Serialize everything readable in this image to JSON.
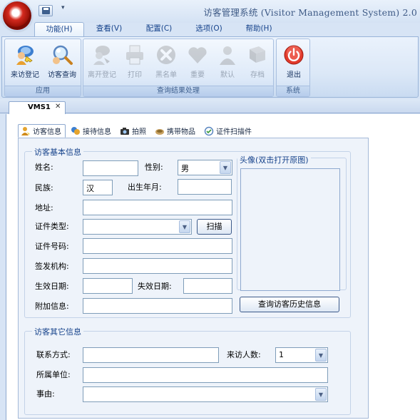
{
  "window": {
    "title": "访客管理系统 (Visitor Management System) 2.0",
    "qat_dropdown": "▾"
  },
  "ribbon_tabs": [
    {
      "label": "功能(H)",
      "active": true
    },
    {
      "label": "查看(V)",
      "active": false
    },
    {
      "label": "配置(C)",
      "active": false
    },
    {
      "label": "选项(O)",
      "active": false
    },
    {
      "label": "帮助(H)",
      "active": false
    }
  ],
  "ribbon_groups": {
    "app": {
      "label": "应用",
      "buttons": [
        {
          "label": "来访登记",
          "icon": "user-key-icon"
        },
        {
          "label": "访客查询",
          "icon": "magnifier-icon"
        }
      ]
    },
    "results": {
      "label": "查询结果处理",
      "buttons": [
        {
          "label": "离开登记",
          "icon": "leave-icon"
        },
        {
          "label": "打印",
          "icon": "printer-icon"
        },
        {
          "label": "黑名单",
          "icon": "blacklist-icon"
        },
        {
          "label": "重要",
          "icon": "heart-icon"
        },
        {
          "label": "默认",
          "icon": "person-icon"
        },
        {
          "label": "存档",
          "icon": "archive-icon"
        }
      ]
    },
    "system": {
      "label": "系统",
      "buttons": [
        {
          "label": "退出",
          "icon": "power-icon"
        }
      ]
    }
  },
  "doc_tab": {
    "label": "VMS1",
    "close": "✕"
  },
  "sub_tabs": [
    {
      "label": "访客信息",
      "icon": "visitor-icon",
      "active": true
    },
    {
      "label": "接待信息",
      "icon": "reception-icon",
      "active": false
    },
    {
      "label": "拍照",
      "icon": "camera-icon",
      "active": false
    },
    {
      "label": "携带物品",
      "icon": "items-icon",
      "active": false
    },
    {
      "label": "证件扫描件",
      "icon": "scan-icon",
      "active": false
    }
  ],
  "basic_info": {
    "title": "访客基本信息",
    "name_label": "姓名:",
    "name_value": "",
    "gender_label": "性别:",
    "gender_value": "男",
    "ethnicity_label": "民族:",
    "ethnicity_value": "汉",
    "birth_label": "出生年月:",
    "birth_value": "",
    "address_label": "地址:",
    "address_value": "",
    "id_type_label": "证件类型:",
    "id_type_value": "",
    "scan_button": "扫描",
    "id_number_label": "证件号码:",
    "id_number_value": "",
    "issuer_label": "签发机构:",
    "issuer_value": "",
    "valid_from_label": "生效日期:",
    "valid_from_value": "",
    "valid_to_label": "失效日期:",
    "valid_to_value": "",
    "extra_label": "附加信息:",
    "extra_value": "",
    "photo_title": "头像(双击打开原图)",
    "history_button": "查询访客历史信息"
  },
  "other_info": {
    "title": "访客其它信息",
    "contact_label": "联系方式:",
    "contact_value": "",
    "visitor_count_label": "来访人数:",
    "visitor_count_value": "1",
    "company_label": "所属单位:",
    "company_value": "",
    "reason_label": "事由:",
    "reason_value": ""
  }
}
